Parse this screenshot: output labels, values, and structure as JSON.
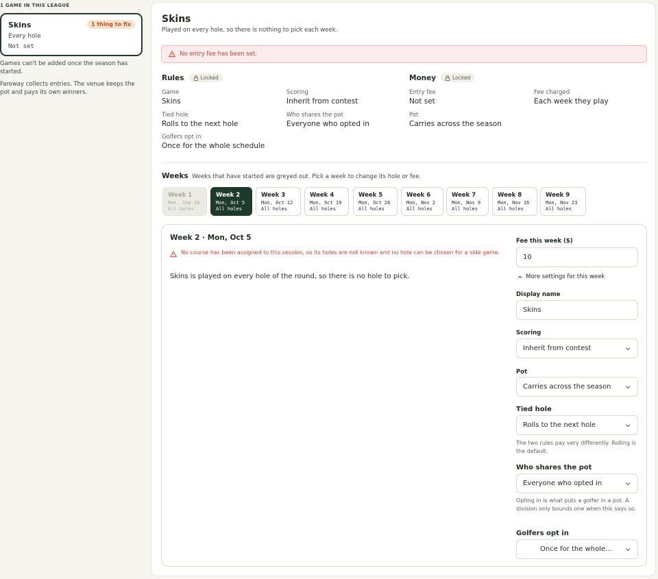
{
  "sidebar": {
    "heading": "1 GAME IN THIS LEAGUE",
    "game": {
      "name": "Skins",
      "badge": "1 thing to fix",
      "hole": "Every hole",
      "fee": "Not set"
    },
    "note1": "Games can't be added once the season has started.",
    "note2": "Fareway collects entries. The venue keeps the pot and pays its own winners."
  },
  "main": {
    "title": "Skins",
    "subtitle": "Played on every hole, so there is nothing to pick each week.",
    "alert": "No entry fee has been set.",
    "rules": {
      "title": "Rules",
      "lock": "Locked",
      "fields": [
        {
          "label": "Game",
          "value": "Skins"
        },
        {
          "label": "Scoring",
          "value": "Inherit from contest"
        },
        {
          "label": "Tied hole",
          "value": "Rolls to the next hole"
        },
        {
          "label": "Who shares the pot",
          "value": "Everyone who opted in"
        },
        {
          "label": "Golfers opt in",
          "value": "Once for the whole schedule"
        }
      ]
    },
    "money": {
      "title": "Money",
      "lock": "Locked",
      "fields": [
        {
          "label": "Entry fee",
          "value": "Not set"
        },
        {
          "label": "Fee charged",
          "value": "Each week they play"
        },
        {
          "label": "Pot",
          "value": "Carries across the season"
        }
      ]
    },
    "weeks": {
      "title": "Weeks",
      "hint": "Weeks that have started are greyed out. Pick a week to change its hole or fee.",
      "items": [
        {
          "label": "Week 1",
          "date": "Mon, Sep 28",
          "holes": "All holes"
        },
        {
          "label": "Week 2",
          "date": "Mon, Oct 5",
          "holes": "All holes"
        },
        {
          "label": "Week 3",
          "date": "Mon, Oct 12",
          "holes": "All holes"
        },
        {
          "label": "Week 4",
          "date": "Mon, Oct 19",
          "holes": "All holes"
        },
        {
          "label": "Week 5",
          "date": "Mon, Oct 26",
          "holes": "All holes"
        },
        {
          "label": "Week 6",
          "date": "Mon, Nov 2",
          "holes": "All holes"
        },
        {
          "label": "Week 7",
          "date": "Mon, Nov 9",
          "holes": "All holes"
        },
        {
          "label": "Week 8",
          "date": "Mon, Nov 16",
          "holes": "All holes"
        },
        {
          "label": "Week 9",
          "date": "Mon, Nov 23",
          "holes": "All holes"
        }
      ]
    },
    "detail": {
      "title": "Week 2 · Mon, Oct 5",
      "warning": "No course has been assigned to this session, so its holes are not known and no hole can be chosen for a side game.",
      "body": "Skins is played on every hole of the round, so there is no hole to pick.",
      "fee_label": "Fee this week ($)",
      "fee_value": "10",
      "more_settings": "More settings for this week",
      "display_name_label": "Display name",
      "display_name_value": "Skins",
      "scoring_label": "Scoring",
      "scoring_value": "Inherit from contest",
      "pot_label": "Pot",
      "pot_value": "Carries across the season",
      "tied_label": "Tied hole",
      "tied_value": "Rolls to the next hole",
      "tied_hint": "The two rules pay very differently. Rolling is the default.",
      "share_label": "Who shares the pot",
      "share_value": "Everyone who opted in",
      "share_hint": "Opting in is what puts a golfer in a pot. A division only bounds one when this says so.",
      "optin_label": "Golfers opt in",
      "optin_value": "Once for the whole…"
    }
  },
  "colors": {
    "accent": "#1e3a2b",
    "error": "#c8412f",
    "badge_bg": "#f7e1cf",
    "badge_text": "#b4591f"
  },
  "icons": {
    "alert": "warning-triangle-icon",
    "lock": "lock-icon",
    "chevron": "chevron-down-icon",
    "collapse": "chevron-up-icon"
  }
}
